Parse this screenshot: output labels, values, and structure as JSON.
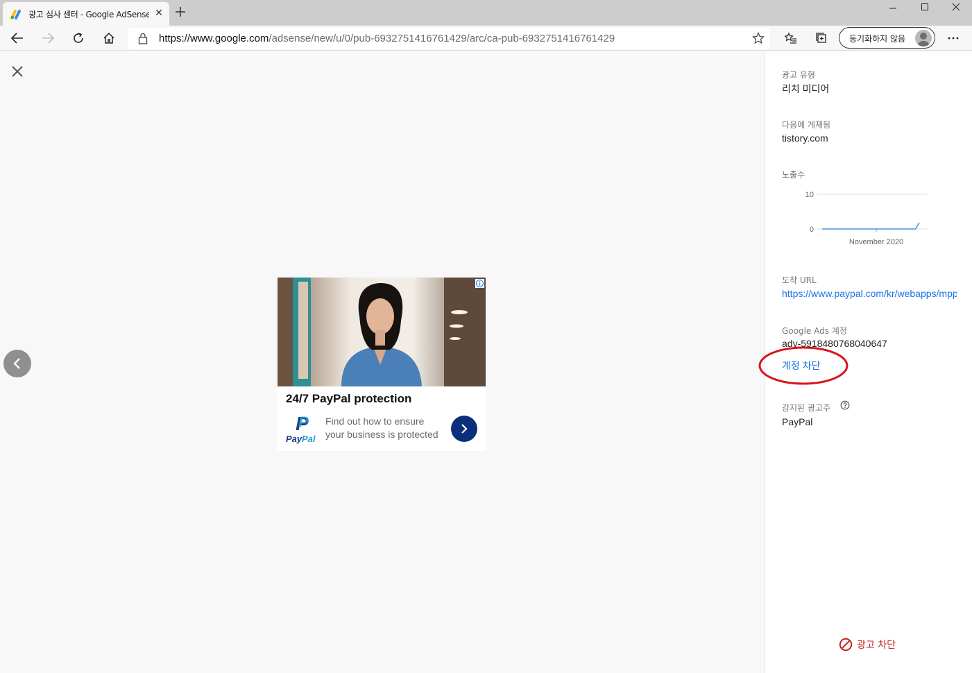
{
  "browser": {
    "tab_title": "광고 심사 센터 - Google AdSense",
    "address_host": "https://www.google.com",
    "address_path": "/adsense/new/u/0/pub-6932751416761429/arc/ca-pub-6932751416761429",
    "sync_label": "동기화하지 않음"
  },
  "ad": {
    "headline": "24/7 PayPal protection",
    "description": "Find out how to ensure your business is protected",
    "logo_text": "PayPal"
  },
  "details": {
    "ad_type_label": "광고 유형",
    "ad_type_value": "리치 미디어",
    "shown_on_label": "다음에 게재됨",
    "shown_on_value": "tistory.com",
    "impressions_label": "노출수",
    "landing_url_label": "도착 URL",
    "landing_url_value": "https://www.paypal.com/kr/webapps/mpp/",
    "ads_account_label": "Google Ads 계정",
    "ads_account_value": "adv-5918480768040647",
    "block_account_label": "계정 차단",
    "advertiser_label": "감지된 광고주",
    "advertiser_value": "PayPal",
    "block_ad_label": "광고 차단"
  },
  "chart_data": {
    "type": "line",
    "title": "",
    "xlabel": "",
    "ylabel": "",
    "x_tick_labels": [
      "November 2020"
    ],
    "y_tick_labels": [
      "10",
      "0"
    ],
    "ylim": [
      0,
      10
    ],
    "series": [
      {
        "values": [
          0,
          0,
          0,
          0,
          0,
          0,
          0,
          0,
          0,
          0,
          0,
          0,
          0,
          0,
          0,
          0,
          0,
          0,
          0,
          0,
          0,
          0,
          0,
          0,
          0,
          0,
          1.8
        ]
      }
    ],
    "grid": true
  },
  "colors": {
    "link": "#1a73e8",
    "block_red": "#c5221f",
    "annotation_red": "#d9131c",
    "chart_line": "#4a8fe0"
  }
}
